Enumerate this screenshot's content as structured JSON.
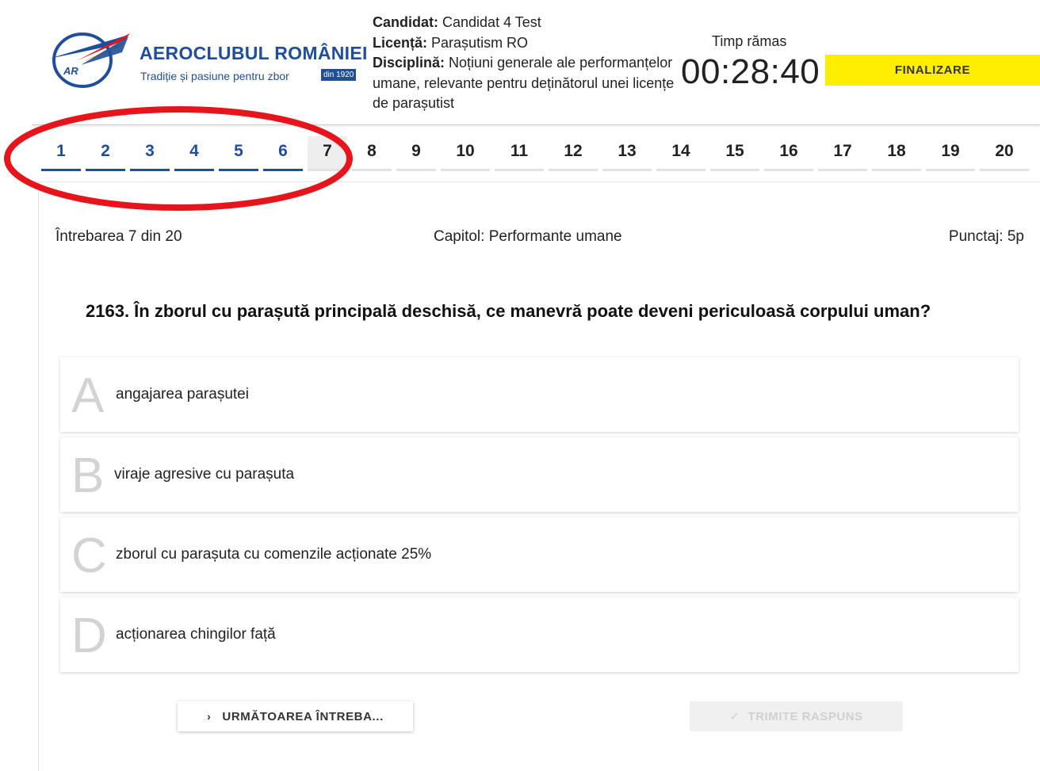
{
  "header": {
    "brand_name": "AEROCLUBUL ROMÂNIEI",
    "brand_tagline": "Tradiție și pasiune pentru zbor",
    "brand_badge": "din 1920",
    "logo_text": "AR",
    "candidate_label": "Candidat:",
    "candidate_value": "Candidat 4 Test",
    "license_label": "Licență:",
    "license_value": "Parașutism RO",
    "discipline_label": "Disciplină:",
    "discipline_value": "Noțiuni generale ale performanțelor umane, relevante pentru deținătorul unei licențe de parașutist",
    "timer_label": "Timp rămas",
    "timer_value": "00:28:40",
    "finish_label": "FINALIZARE"
  },
  "tabs": {
    "items": [
      "1",
      "2",
      "3",
      "4",
      "5",
      "6",
      "7",
      "8",
      "9",
      "10",
      "11",
      "12",
      "13",
      "14",
      "15",
      "16",
      "17",
      "18",
      "19",
      "20"
    ],
    "answered_count": 6,
    "current": 7
  },
  "question": {
    "progress": "Întrebarea 7 din 20",
    "chapter": "Capitol: Performante umane",
    "score": "Punctaj: 5p",
    "text": "2163. În zborul cu parașută principală deschisă, ce manevră poate deveni periculoasă corpului uman?"
  },
  "answers": [
    {
      "letter": "A",
      "text": "angajarea parașutei"
    },
    {
      "letter": "B",
      "text": "viraje agresive cu parașuta"
    },
    {
      "letter": "C",
      "text": "zborul cu parașuta cu comenzile acționate 25%"
    },
    {
      "letter": "D",
      "text": "acționarea chingilor față"
    }
  ],
  "buttons": {
    "next_label": "URMĂTOAREA ÎNTREBA...",
    "next_icon": "chevron-right-icon",
    "submit_label": "TRIMITE RASPUNS",
    "submit_icon": "check-icon"
  },
  "colors": {
    "brand_blue": "#1f4e9c",
    "finish_yellow": "#ffee00",
    "annotation_red": "#e8141c"
  }
}
